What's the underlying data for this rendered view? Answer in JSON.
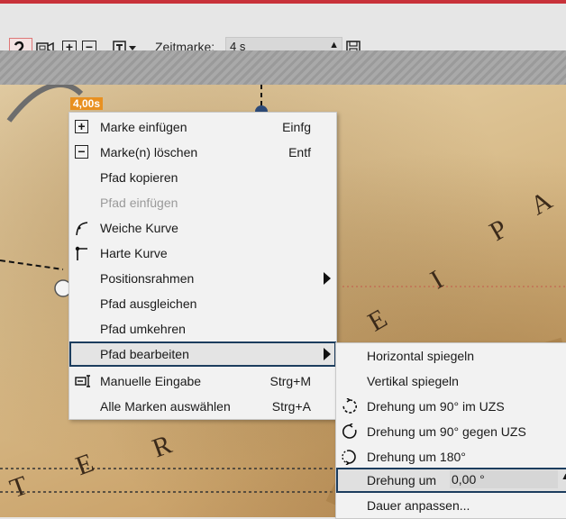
{
  "toolbar": {
    "zeit_label": "Zeitmarke:",
    "zeit_value": "4 s",
    "icons": [
      "curve-tool-icon",
      "camera-icon",
      "add-mark-icon",
      "remove-mark-icon",
      "path-options-icon",
      "save-icon"
    ]
  },
  "map": {
    "badge": "4,00s",
    "letters": [
      "P",
      "A",
      "E",
      "I",
      "R",
      "E",
      "T",
      "E",
      "R"
    ]
  },
  "context_menu": {
    "items": [
      {
        "label": "Marke einfügen",
        "shortcut": "Einfg",
        "icon": "plus-box-icon",
        "disabled": false
      },
      {
        "label": "Marke(n) löschen",
        "shortcut": "Entf",
        "icon": "minus-box-icon",
        "disabled": false
      },
      {
        "label": "Pfad kopieren",
        "shortcut": "",
        "icon": "",
        "disabled": false
      },
      {
        "label": "Pfad einfügen",
        "shortcut": "",
        "icon": "",
        "disabled": true
      },
      {
        "label": "Weiche Kurve",
        "shortcut": "",
        "icon": "soft-curve-icon",
        "disabled": false
      },
      {
        "label": "Harte Kurve",
        "shortcut": "",
        "icon": "hard-curve-icon",
        "disabled": false
      },
      {
        "label": "Positionsrahmen",
        "shortcut": "",
        "icon": "",
        "disabled": false,
        "submenu": true
      },
      {
        "label": "Pfad ausgleichen",
        "shortcut": "",
        "icon": "",
        "disabled": false
      },
      {
        "label": "Pfad umkehren",
        "shortcut": "",
        "icon": "",
        "disabled": false
      },
      {
        "label": "Pfad bearbeiten",
        "shortcut": "",
        "icon": "",
        "disabled": false,
        "submenu": true,
        "highlighted": true
      },
      {
        "label": "Manuelle Eingabe",
        "shortcut": "Strg+M",
        "icon": "manual-input-icon",
        "disabled": false
      },
      {
        "label": "Alle Marken auswählen",
        "shortcut": "Strg+A",
        "icon": "",
        "disabled": false
      }
    ]
  },
  "submenu": {
    "items": [
      {
        "label": "Horizontal spiegeln",
        "icon": ""
      },
      {
        "label": "Vertikal spiegeln",
        "icon": ""
      },
      {
        "label": "Drehung um 90° im UZS",
        "icon": "rotate-cw-icon"
      },
      {
        "label": "Drehung um 90° gegen UZS",
        "icon": "rotate-ccw-icon"
      },
      {
        "label": "Drehung um 180°",
        "icon": "rotate-180-icon"
      },
      {
        "label": "Drehung um",
        "icon": "",
        "input_value": "0,00 °",
        "highlighted": true
      },
      {
        "label": "Dauer anpassen...",
        "icon": ""
      }
    ]
  },
  "colors": {
    "accent": "#1c3d5e",
    "top_line": "#c8323a",
    "path_point": "#e89020"
  }
}
